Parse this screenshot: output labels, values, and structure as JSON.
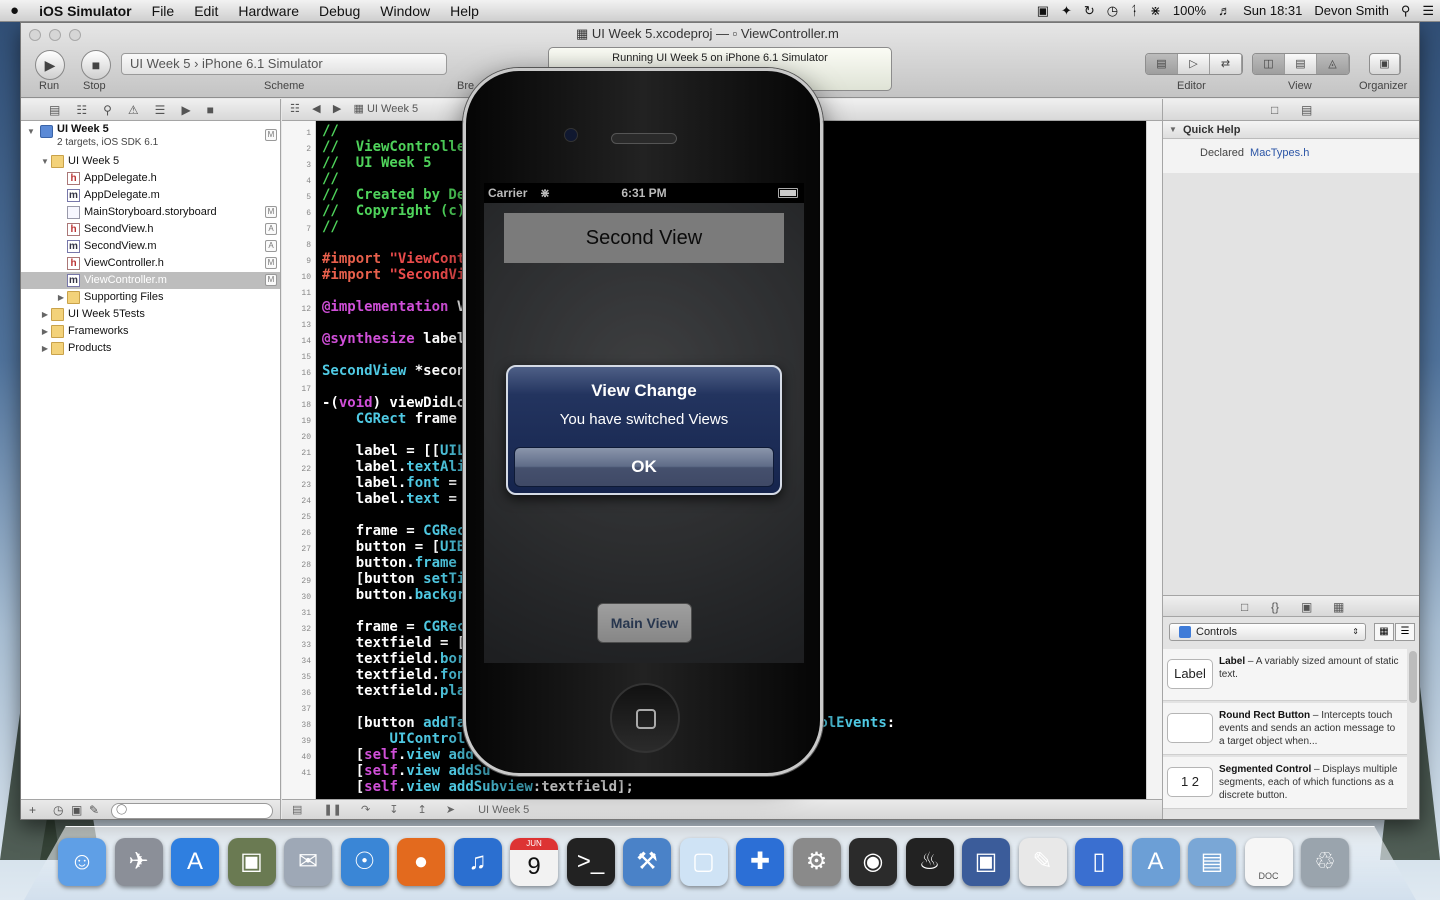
{
  "menubar": {
    "apple": "",
    "app_name": "iOS Simulator",
    "menus": [
      "File",
      "Edit",
      "Hardware",
      "Debug",
      "Window",
      "Help"
    ],
    "battery": "100%",
    "clock": "Sun 18:31",
    "user": "Devon Smith"
  },
  "window": {
    "title_project": "UI Week 5.xcodeproj",
    "title_sep": "—",
    "title_file": "ViewController.m"
  },
  "toolbar": {
    "run_label": "Run",
    "stop_label": "Stop",
    "scheme_target": "UI Week 5",
    "scheme_device": "iPhone 6.1 Simulator",
    "scheme_label": "Scheme",
    "breakpoints_label": "Bre",
    "activity_text": "Running UI Week 5 on iPhone 6.1 Simulator",
    "editor_label": "Editor",
    "view_label": "View",
    "organizer_label": "Organizer"
  },
  "jumpbar": {
    "crumb": "UI Week 5"
  },
  "navigator": {
    "project_name": "UI Week 5",
    "project_sub": "2 targets, iOS SDK 6.1",
    "items": [
      {
        "label": "UI Week 5",
        "type": "folder",
        "level": 1,
        "disclosure": "open"
      },
      {
        "label": "AppDelegate.h",
        "type": "h",
        "level": 2
      },
      {
        "label": "AppDelegate.m",
        "type": "m",
        "level": 2
      },
      {
        "label": "MainStoryboard.storyboard",
        "type": "sb",
        "level": 2,
        "badge": "M"
      },
      {
        "label": "SecondView.h",
        "type": "h",
        "level": 2,
        "badge": "A"
      },
      {
        "label": "SecondView.m",
        "type": "m",
        "level": 2,
        "badge": "A"
      },
      {
        "label": "ViewController.h",
        "type": "h",
        "level": 2,
        "badge": "M"
      },
      {
        "label": "ViewController.m",
        "type": "m",
        "level": 2,
        "badge": "M",
        "selected": true
      },
      {
        "label": "Supporting Files",
        "type": "folder",
        "level": 2,
        "disclosure": "closed"
      },
      {
        "label": "UI Week 5Tests",
        "type": "folder",
        "level": 1,
        "disclosure": "closed"
      },
      {
        "label": "Frameworks",
        "type": "folder",
        "level": 1,
        "disclosure": "closed"
      },
      {
        "label": "Products",
        "type": "folder",
        "level": 1,
        "disclosure": "closed"
      }
    ],
    "project_badge": "M"
  },
  "editor": {
    "line_numbers": [
      "1",
      "2",
      "3",
      "4",
      "5",
      "6",
      "7",
      "8",
      "9",
      "10",
      "11",
      "12",
      "13",
      "14",
      "15",
      "16",
      "17",
      "18",
      "19",
      "20",
      "21",
      "22",
      "23",
      "24",
      "25",
      "26",
      "27",
      "28",
      "29",
      "30",
      "31",
      "32",
      "33",
      "34",
      "35",
      "36",
      "37",
      "38",
      "39",
      "40",
      "41"
    ],
    "lines": [
      [
        {
          "c": "cm",
          "t": "//"
        }
      ],
      [
        {
          "c": "cm",
          "t": "//  ViewControlle"
        }
      ],
      [
        {
          "c": "cm",
          "t": "//  UI Week 5"
        }
      ],
      [
        {
          "c": "cm",
          "t": "//"
        }
      ],
      [
        {
          "c": "cm",
          "t": "//  Created by De"
        }
      ],
      [
        {
          "c": "cm",
          "t": "//  Copyright (c)"
        }
      ],
      [
        {
          "c": "cm",
          "t": "//"
        }
      ],
      [],
      [
        {
          "c": "pp",
          "t": "#import "
        },
        {
          "c": "st",
          "t": "\"ViewCont"
        }
      ],
      [
        {
          "c": "pp",
          "t": "#import "
        },
        {
          "c": "st",
          "t": "\"SecondVi"
        }
      ],
      [],
      [
        {
          "c": "kw",
          "t": "@implementation"
        },
        {
          "c": "",
          "t": " V"
        }
      ],
      [],
      [
        {
          "c": "kw",
          "t": "@synthesize"
        },
        {
          "c": "",
          "t": " label"
        }
      ],
      [],
      [
        {
          "c": "ty",
          "t": "SecondView"
        },
        {
          "c": "",
          "t": " *secon"
        }
      ],
      [],
      [
        {
          "c": "",
          "t": "-("
        },
        {
          "c": "kw",
          "t": "void"
        },
        {
          "c": "",
          "t": ") viewDidLo"
        }
      ],
      [
        {
          "c": "",
          "t": "    "
        },
        {
          "c": "ty",
          "t": "CGRect"
        },
        {
          "c": "",
          "t": " frame"
        }
      ],
      [],
      [
        {
          "c": "",
          "t": "    label = [["
        },
        {
          "c": "ty",
          "t": "UIL"
        }
      ],
      [
        {
          "c": "",
          "t": "    label."
        },
        {
          "c": "ty",
          "t": "textAli"
        }
      ],
      [
        {
          "c": "",
          "t": "    label."
        },
        {
          "c": "ty",
          "t": "font"
        },
        {
          "c": "",
          "t": " ="
        }
      ],
      [
        {
          "c": "",
          "t": "    label."
        },
        {
          "c": "ty",
          "t": "text"
        },
        {
          "c": "",
          "t": " ="
        }
      ],
      [],
      [
        {
          "c": "",
          "t": "    frame = "
        },
        {
          "c": "ty",
          "t": "CGRec"
        }
      ],
      [
        {
          "c": "",
          "t": "    button = ["
        },
        {
          "c": "ty",
          "t": "UIB"
        },
        {
          "c": "",
          "t": "                                      "
        },
        {
          "c": "ty",
          "t": "t"
        },
        {
          "c": "",
          "t": "];"
        }
      ],
      [
        {
          "c": "",
          "t": "    button."
        },
        {
          "c": "ty",
          "t": "frame"
        }
      ],
      [
        {
          "c": "",
          "t": "    [button "
        },
        {
          "c": "ty",
          "t": "setTi"
        }
      ],
      [
        {
          "c": "",
          "t": "    button."
        },
        {
          "c": "ty",
          "t": "backgr"
        }
      ],
      [],
      [
        {
          "c": "",
          "t": "    frame = "
        },
        {
          "c": "ty",
          "t": "CGRec"
        }
      ],
      [
        {
          "c": "",
          "t": "    textfield = ["
        }
      ],
      [
        {
          "c": "",
          "t": "    textfield."
        },
        {
          "c": "ty",
          "t": "bor"
        }
      ],
      [
        {
          "c": "",
          "t": "    textfield."
        },
        {
          "c": "ty",
          "t": "fon"
        }
      ],
      [
        {
          "c": "",
          "t": "    textfield."
        },
        {
          "c": "ty",
          "t": "pla"
        }
      ],
      [],
      [
        {
          "c": "",
          "t": "    [button "
        },
        {
          "c": "ty",
          "t": "addTa"
        },
        {
          "c": "",
          "t": "                                  "
        },
        {
          "c": "ty",
          "t": "forControlEvents"
        },
        {
          "c": "",
          "t": ":"
        }
      ],
      [
        {
          "c": "",
          "t": "        "
        },
        {
          "c": "ty",
          "t": "UIControl"
        }
      ],
      [
        {
          "c": "",
          "t": "    ["
        },
        {
          "c": "kw",
          "t": "self"
        },
        {
          "c": "",
          "t": "."
        },
        {
          "c": "ty",
          "t": "view"
        },
        {
          "c": "",
          "t": " "
        },
        {
          "c": "ty",
          "t": "add"
        }
      ],
      [
        {
          "c": "",
          "t": "    ["
        },
        {
          "c": "kw",
          "t": "self"
        },
        {
          "c": "",
          "t": "."
        },
        {
          "c": "ty",
          "t": "view"
        },
        {
          "c": "",
          "t": " "
        },
        {
          "c": "ty",
          "t": "addSu"
        }
      ],
      [
        {
          "c": "",
          "t": "    ["
        },
        {
          "c": "kw",
          "t": "self"
        },
        {
          "c": "",
          "t": "."
        },
        {
          "c": "ty",
          "t": "view"
        },
        {
          "c": "",
          "t": " "
        },
        {
          "c": "ty",
          "t": "addSubview"
        },
        {
          "c": "",
          "t": ":textfield];"
        }
      ]
    ]
  },
  "debugbar": {
    "target": "UI Week 5"
  },
  "inspector": {
    "quick_help_title": "Quick Help",
    "declared_label": "Declared",
    "declared_value": "MacTypes.h",
    "library_popup": "Controls",
    "library_items": [
      {
        "icon": "Label",
        "name": "Label",
        "desc": " – A variably sized amount of static text."
      },
      {
        "icon": "",
        "name": "Round Rect Button",
        "desc": " – Intercepts touch events and sends an action message to a target object when..."
      },
      {
        "icon": "1 2",
        "name": "Segmented Control",
        "desc": " – Displays multiple segments, each of which functions as a discrete button."
      }
    ]
  },
  "simulator": {
    "carrier": "Carrier",
    "time": "6:31 PM",
    "second_view_label": "Second View",
    "alert_title": "View Change",
    "alert_message": "You have switched Views",
    "alert_button": "OK",
    "main_view_button": "Main View"
  },
  "dock": {
    "items": [
      "finder",
      "launchpad",
      "app-store",
      "image-capture",
      "mail",
      "safari",
      "firefox",
      "itunes",
      "calendar",
      "terminal",
      "xcode",
      "cube",
      "instruments",
      "system-preferences",
      "photo-booth",
      "steam",
      "virtualbox",
      "textedit",
      "ios-simulator",
      "applications",
      "documents",
      "doc",
      "trash"
    ],
    "calendar_day": "9",
    "calendar_month": "JUN",
    "doc_label": "DOC"
  },
  "colors": {
    "code_bg": "#000000",
    "comment": "#4fd35b",
    "keyword": "#d04fd8",
    "type": "#4fc9e3",
    "string": "#ea4b4b",
    "alert_blue": "#15244d",
    "selection": "#bdbdbd"
  }
}
